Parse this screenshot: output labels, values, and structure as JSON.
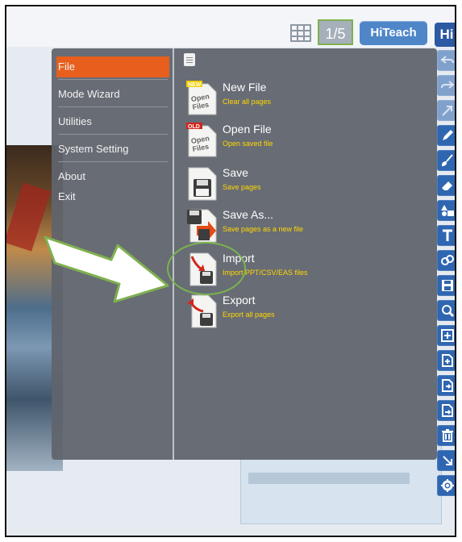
{
  "topbar": {
    "page_indicator": "1/5",
    "hiteach_label": "HiTeach",
    "logo_text": "Hi"
  },
  "menu": {
    "items": [
      {
        "label": "File",
        "active": true
      },
      {
        "label": "Mode Wizard",
        "active": false
      },
      {
        "label": "Utilities",
        "active": false
      },
      {
        "label": "System Setting",
        "active": false
      },
      {
        "label": "About",
        "active": false
      },
      {
        "label": "Exit",
        "active": false
      }
    ]
  },
  "file_options": [
    {
      "title": "New File",
      "desc": "Clear all pages",
      "icon": "new-file-icon",
      "badge": "NEW",
      "icon_text": "Open Files"
    },
    {
      "title": "Open File",
      "desc": "Open saved file",
      "icon": "open-file-icon",
      "badge": "OLD",
      "icon_text": "Open Files"
    },
    {
      "title": "Save",
      "desc": "Save pages",
      "icon": "save-icon"
    },
    {
      "title": "Save As...",
      "desc": "Save pages as a new file",
      "icon": "save-as-icon"
    },
    {
      "title": "Import",
      "desc": "Import PPT/CSV/EAS files",
      "icon": "import-icon"
    },
    {
      "title": "Export",
      "desc": "Export all pages",
      "icon": "export-icon"
    }
  ],
  "toolbar_icons": [
    "undo-icon",
    "redo-icon",
    "pointer-icon",
    "pen-icon",
    "brush-icon",
    "eraser-icon",
    "shapes-icon",
    "text-icon",
    "link-icon",
    "save-page-icon",
    "zoom-icon",
    "add-page-icon",
    "insert-page-icon",
    "insert-page-after-icon",
    "duplicate-page-icon",
    "delete-page-icon",
    "collapse-icon",
    "settings-icon"
  ],
  "colors": {
    "menu_active": "#e85f1d",
    "toolbar_blue": "#2f66b1",
    "desc_yellow": "#ffd700",
    "highlight_green": "#79b34e"
  }
}
